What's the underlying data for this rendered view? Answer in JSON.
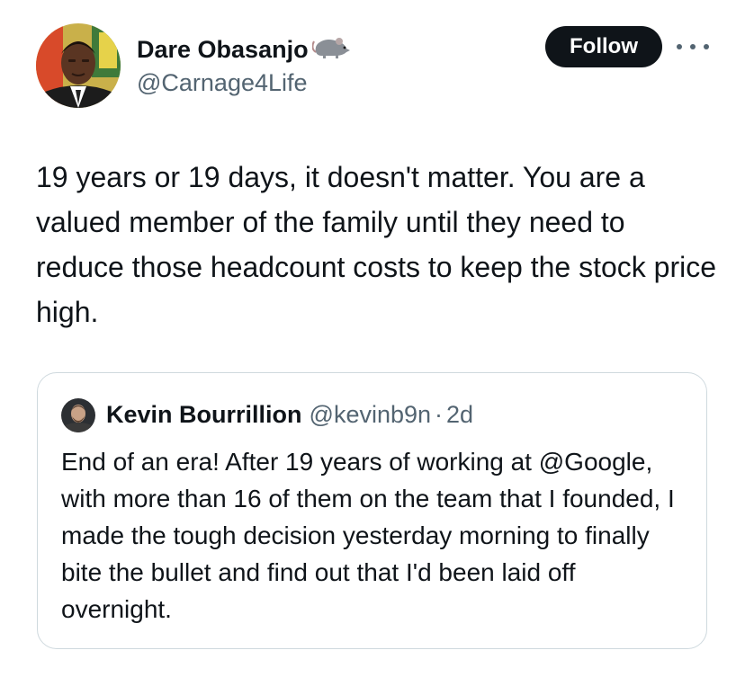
{
  "author": {
    "name": "Dare Obasanjo",
    "handle": "@Carnage4Life",
    "emoji_icon": "rat-icon"
  },
  "actions": {
    "follow_label": "Follow",
    "more_icon": "more-horizontal-icon"
  },
  "tweet": {
    "text": "19 years or 19 days, it doesn't matter. You are a valued member of the family until they need to reduce those headcount costs to keep the stock price high."
  },
  "quoted_tweet": {
    "author_name": "Kevin Bourrillion",
    "author_handle": "@kevinb9n",
    "separator": "·",
    "time": "2d",
    "text": "End of an era! After 19 years of working at @Google, with more than 16 of them on the team that I founded, I made the tough decision yesterday morning to finally bite the bullet and find out that I'd been laid off overnight."
  },
  "colors": {
    "text_primary": "#0f1419",
    "text_secondary": "#536471",
    "follow_bg": "#0f1419",
    "border": "#cfd9de"
  }
}
